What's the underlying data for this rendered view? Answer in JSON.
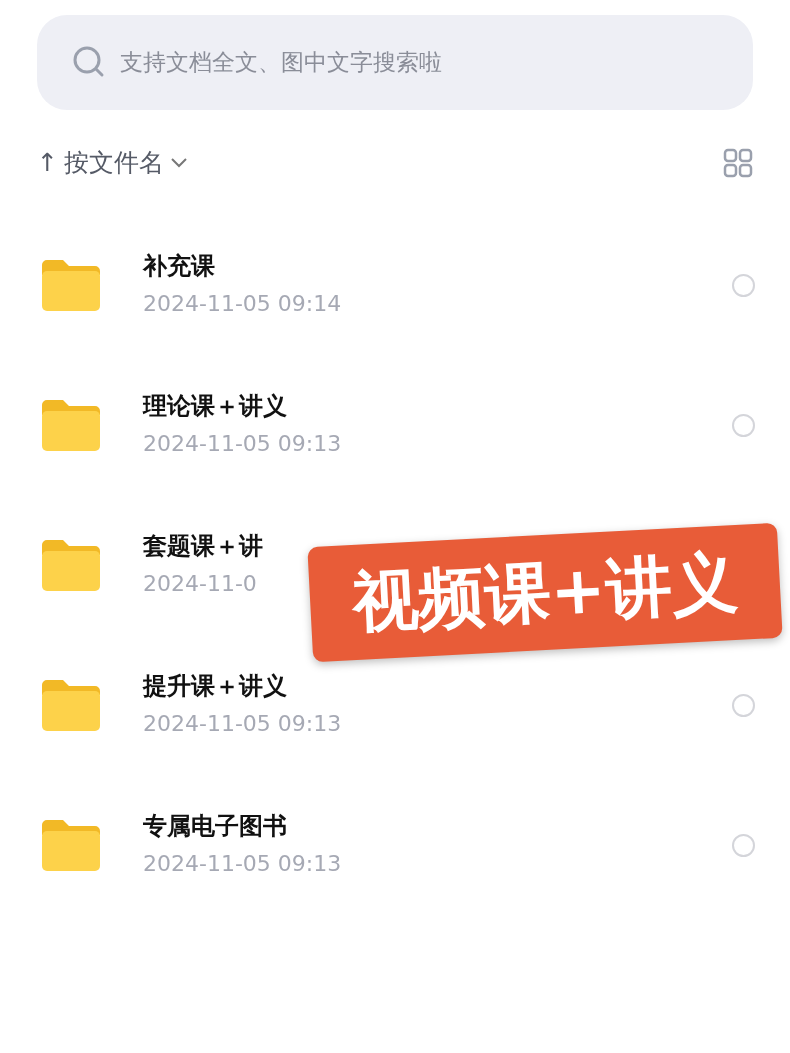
{
  "search": {
    "placeholder": "支持文档全文、图中文字搜索啦"
  },
  "sort": {
    "arrow": "↑",
    "label": "按文件名"
  },
  "files": [
    {
      "name": "补充课",
      "date": "2024-11-05 09:14",
      "selected": false
    },
    {
      "name": "理论课＋讲义",
      "date": "2024-11-05 09:13",
      "selected": false
    },
    {
      "name": "套题课＋讲",
      "date": "2024-11-0"
    },
    {
      "name": "提升课＋讲义",
      "date": "2024-11-05 09:13",
      "selected": false
    },
    {
      "name": "专属电子图书",
      "date": "2024-11-05 09:13",
      "selected": false
    }
  ],
  "sticker": {
    "text": "视频课+讲义"
  }
}
